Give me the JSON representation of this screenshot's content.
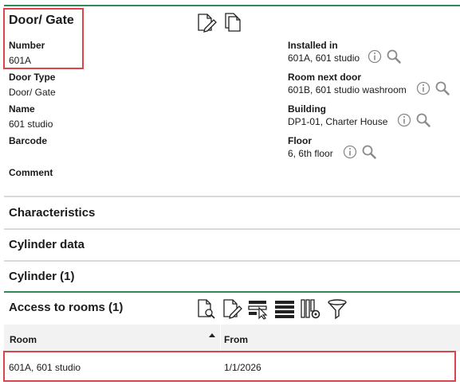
{
  "door": {
    "title": "Door/ Gate",
    "fields_left": [
      {
        "label": "Number",
        "value": "601A"
      },
      {
        "label": "Door Type",
        "value": "Door/ Gate"
      },
      {
        "label": "Name",
        "value": "601 studio"
      },
      {
        "label": "Barcode",
        "value": ""
      },
      {
        "label": "Comment",
        "value": ""
      }
    ],
    "fields_right": [
      {
        "label": "Installed in",
        "value": "601A, 601 studio"
      },
      {
        "label": "Room next door",
        "value": "601B, 601 studio washroom"
      },
      {
        "label": "Building",
        "value": "DP1-01, Charter House"
      },
      {
        "label": "Floor",
        "value": "6, 6th floor"
      }
    ]
  },
  "sections": {
    "characteristics": "Characteristics",
    "cylinder_data": "Cylinder data",
    "cylinder": "Cylinder (1)"
  },
  "access": {
    "title": "Access to rooms (1)",
    "columns": [
      "Room",
      "From"
    ],
    "rows": [
      {
        "room": "601A, 601 studio",
        "from": "1/1/2026"
      }
    ]
  },
  "colors": {
    "accent_green": "#2e8b57",
    "highlight_red": "#d9454a",
    "icon_grey": "#8a8a8a"
  }
}
